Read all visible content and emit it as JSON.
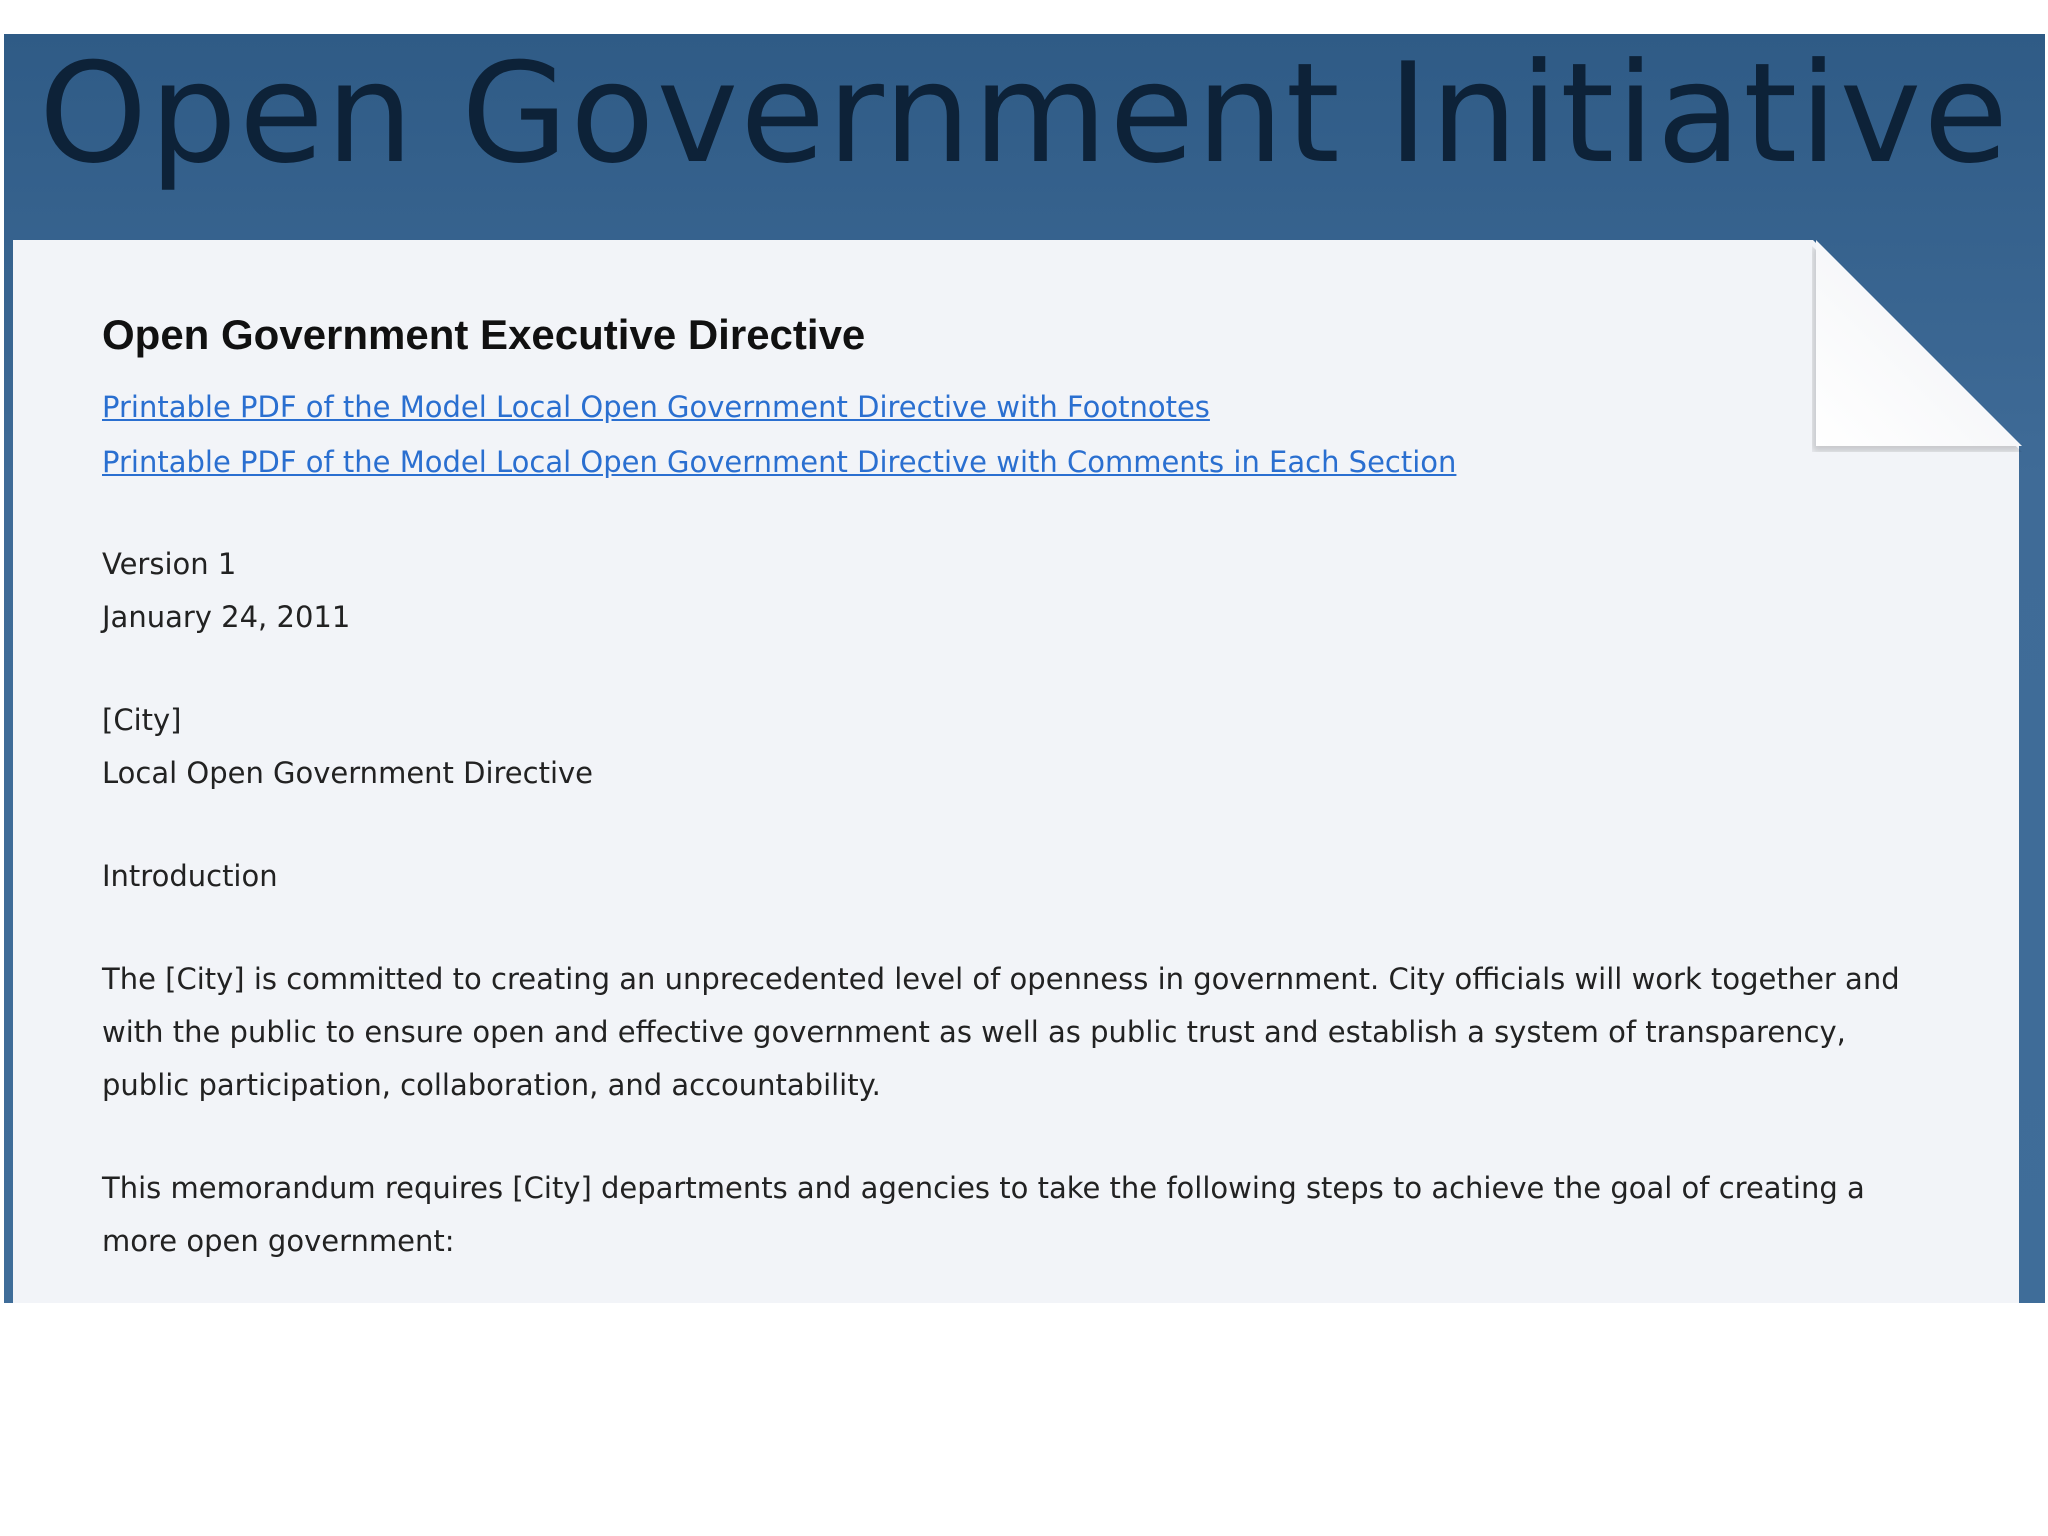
{
  "header": {
    "site_title": "Open Government Initiative"
  },
  "document": {
    "title": "Open Government Executive Directive",
    "links": [
      "Printable PDF of the Model Local Open Government Directive with Footnotes",
      "Printable PDF of the Model Local Open Government Directive with Comments in Each Section"
    ],
    "version": "Version 1",
    "date": "January 24, 2011",
    "city": "[City]",
    "directive_name": "Local Open Government Directive",
    "section_heading": "Introduction",
    "paragraphs": [
      "The [City] is committed to creating an unprecedented level of openness in government.  City officials will work together and with the public to ensure open and effective government as well as public trust and establish a system of transparency, public participation, collaboration, and accountability.",
      "This memorandum requires [City] departments and agencies to take the following steps to achieve the goal of creating a more open government:"
    ]
  },
  "colors": {
    "header_blue": "#3f6b97",
    "title_text": "#0d2238",
    "paper": "#f2f4f8",
    "link": "#2a6fd0"
  }
}
